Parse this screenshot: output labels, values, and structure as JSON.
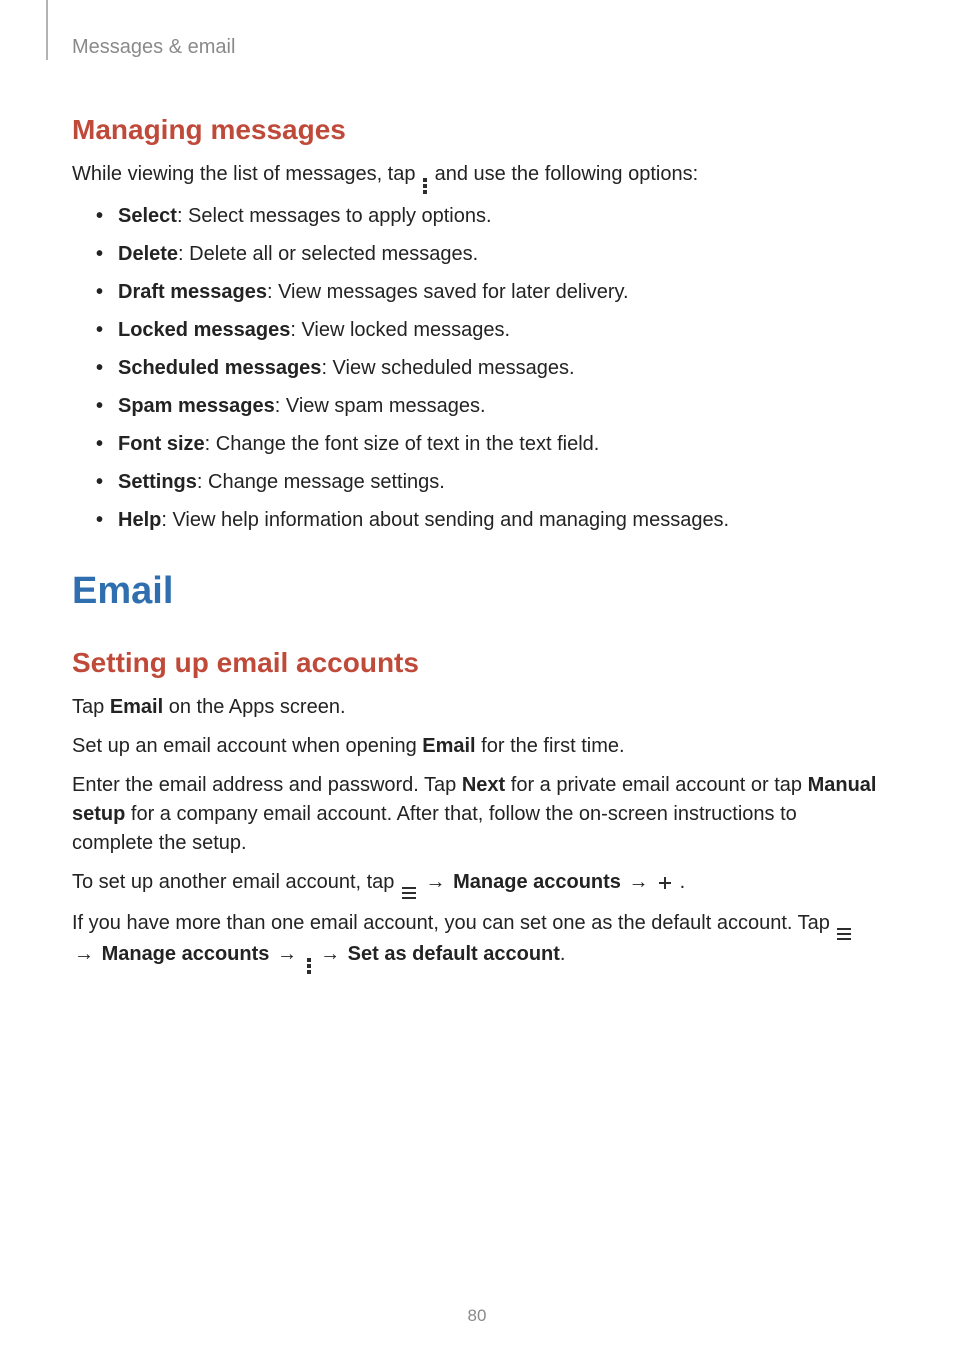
{
  "header": {
    "breadcrumb": "Messages & email"
  },
  "section1": {
    "title": "Managing messages",
    "intro_pre": "While viewing the list of messages, tap ",
    "intro_post": " and use the following options:",
    "bullets": [
      {
        "term": "Select",
        "desc": ": Select messages to apply options."
      },
      {
        "term": "Delete",
        "desc": ": Delete all or selected messages."
      },
      {
        "term": "Draft messages",
        "desc": ": View messages saved for later delivery."
      },
      {
        "term": "Locked messages",
        "desc": ": View locked messages."
      },
      {
        "term": "Scheduled messages",
        "desc": ": View scheduled messages."
      },
      {
        "term": "Spam messages",
        "desc": ": View spam messages."
      },
      {
        "term": "Font size",
        "desc": ": Change the font size of text in the text field."
      },
      {
        "term": "Settings",
        "desc": ": Change message settings."
      },
      {
        "term": "Help",
        "desc": ": View help information about sending and managing messages."
      }
    ]
  },
  "section2": {
    "title": "Email",
    "subtitle": "Setting up email accounts",
    "p1_pre": "Tap ",
    "p1_bold": "Email",
    "p1_post": " on the Apps screen.",
    "p2_pre": "Set up an email account when opening ",
    "p2_bold": "Email",
    "p2_post": " for the first time.",
    "p3_pre": "Enter the email address and password. Tap ",
    "p3_b1": "Next",
    "p3_mid": " for a private email account or tap ",
    "p3_b2": "Manual setup",
    "p3_post": " for a company email account. After that, follow the on-screen instructions to complete the setup.",
    "p4_pre": "To set up another email account, tap ",
    "p4_arrow1": " → ",
    "p4_b1": "Manage accounts",
    "p4_arrow2": " → ",
    "p4_post": ".",
    "p5_pre": "If you have more than one email account, you can set one as the default account. Tap ",
    "p5_arrow1": " → ",
    "p5_b1": "Manage accounts",
    "p5_arrow2": " → ",
    "p5_arrow3": " → ",
    "p5_b2": "Set as default account",
    "p5_post": "."
  },
  "page_number": "80"
}
